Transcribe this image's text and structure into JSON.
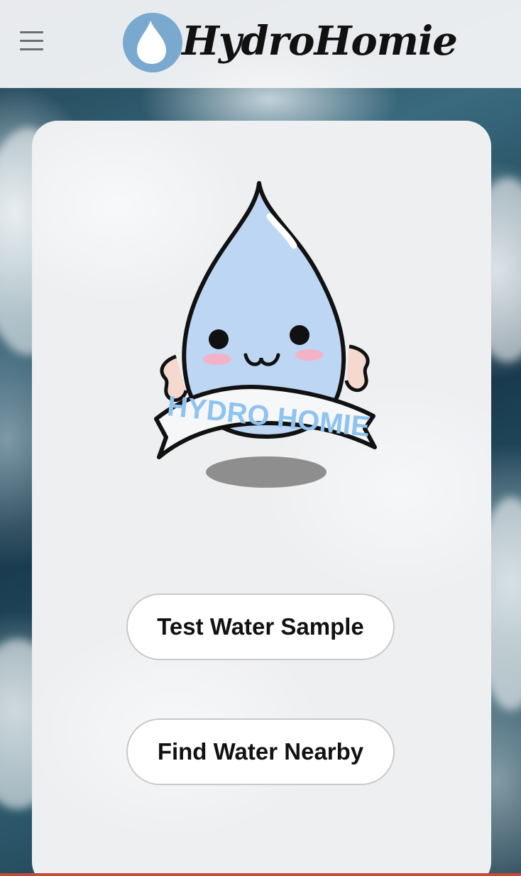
{
  "header": {
    "brand_name": "HydroHomie",
    "menu_icon": "hamburger-menu-icon",
    "logo_icon": "water-drop-icon"
  },
  "hero": {
    "mascot_image": "water-drop-mascot",
    "banner_text": "HYDRO HOMIE"
  },
  "actions": {
    "test_water_label": "Test Water Sample",
    "find_water_label": "Find Water Nearby"
  },
  "colors": {
    "logo_circle": "#7aa9cf",
    "mascot_fill": "#bdd6f4",
    "banner_text": "#8fc3f0",
    "bottom_accent": "#c64a3a"
  }
}
